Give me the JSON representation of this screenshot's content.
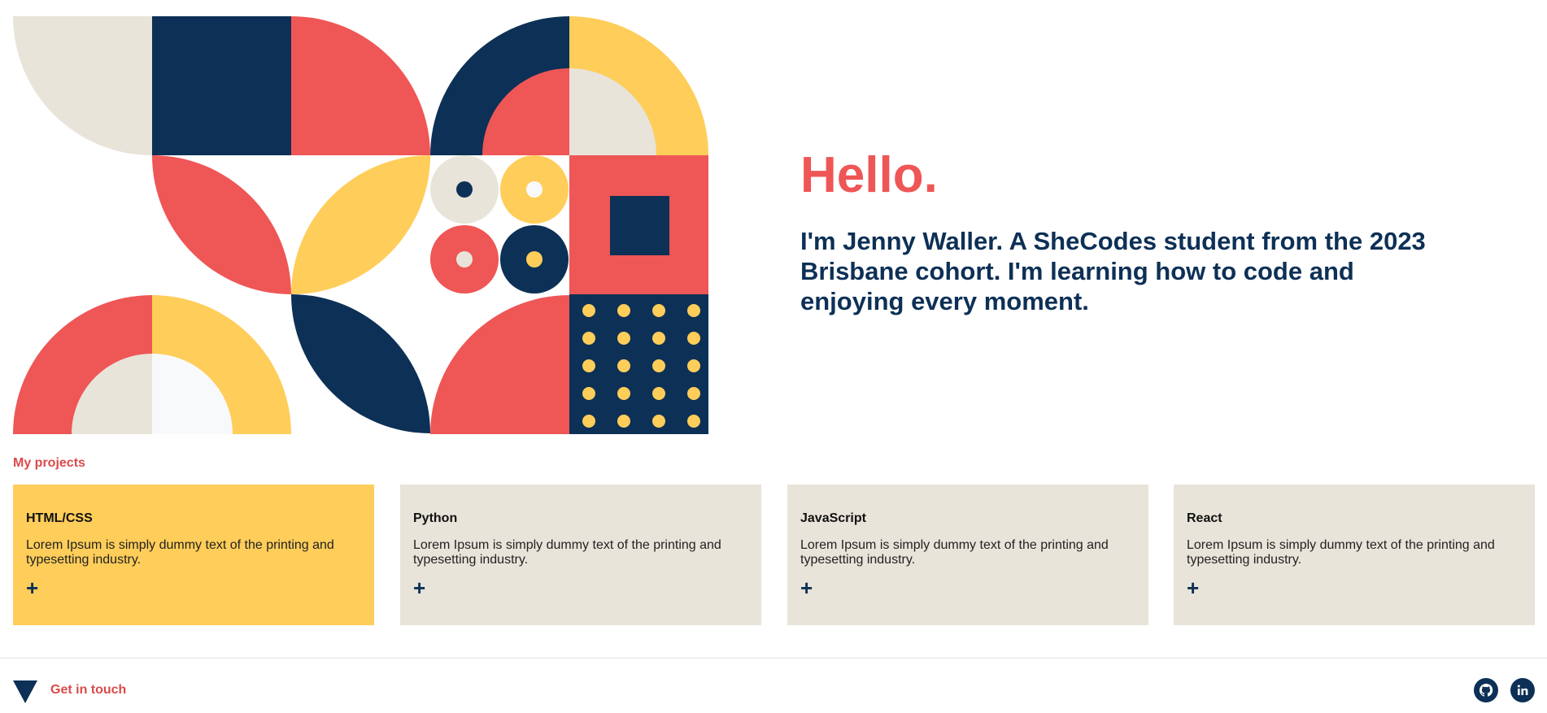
{
  "hero": {
    "greeting": "Hello.",
    "intro": "I'm Jenny Waller. A SheCodes student from the 2023 Brisbane cohort. I'm learning how to code and enjoying every moment."
  },
  "projects": {
    "heading": "My projects",
    "items": [
      {
        "title": "HTML/CSS",
        "description": "Lorem Ipsum is simply dummy text of the printing and typesetting industry.",
        "icon": "plus-icon",
        "color": "#ffcd59"
      },
      {
        "title": "Python",
        "description": "Lorem Ipsum is simply dummy text of the printing and typesetting industry.",
        "icon": "plus-icon",
        "color": "#e8e4d9"
      },
      {
        "title": "JavaScript",
        "description": "Lorem Ipsum is simply dummy text of the printing and typesetting industry.",
        "icon": "plus-icon",
        "color": "#e8e4d9"
      },
      {
        "title": "React",
        "description": "Lorem Ipsum is simply dummy text of the printing and typesetting industry.",
        "icon": "plus-icon",
        "color": "#e8e4d9"
      }
    ]
  },
  "footer": {
    "cta_label": "Get in touch",
    "cta_icon": "triangle-down-icon",
    "social": [
      {
        "name": "github-icon"
      },
      {
        "name": "linkedin-icon"
      }
    ]
  },
  "colors": {
    "navy": "#0d3056",
    "coral": "#ef5656",
    "yellow": "#ffcd59",
    "cream": "#e8e4d9",
    "white": "#f8f9fb"
  }
}
